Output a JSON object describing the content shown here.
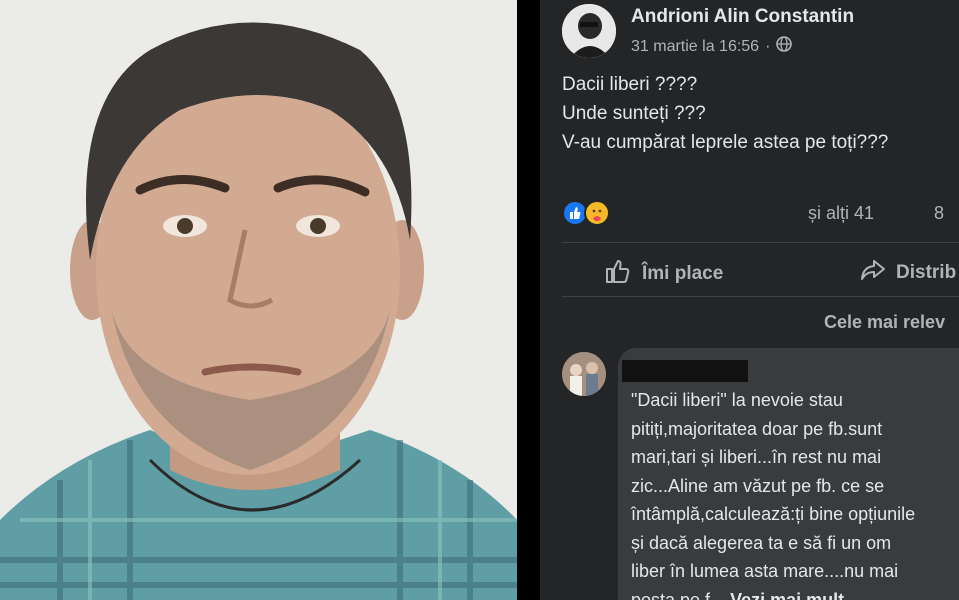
{
  "post": {
    "author": "Andrioni Alin Constantin",
    "timestamp": "31 martie la 16:56",
    "separator": "·",
    "privacy_icon": "globe-icon",
    "lines": [
      "Dacii liberi ????",
      "Unde sunteți ???",
      "V-au cumpărat leprele astea pe toți???"
    ],
    "reactions": [
      "like",
      "care"
    ],
    "others": "și alți 41",
    "comments_count": "8"
  },
  "actions": {
    "like": "Îmi place",
    "share": "Distrib"
  },
  "sort_label": "Cele mai relev",
  "comment": {
    "lines": [
      "\"Dacii liberi\" la nevoie stau",
      "pitiți,majoritatea doar pe fb.sunt",
      "mari,tari și liberi...în rest nu mai",
      "zic...Aline am văzut pe fb. ce se",
      "întâmplă,calculează:ți bine opțiunile",
      "și dacă alegerea ta e să fi un om",
      "liber în lumea asta mare....nu mai"
    ],
    "last_line": "posta pe f...",
    "see_more": "Vezi mai mult"
  },
  "colors": {
    "panel": "#242526",
    "text": "#e4e6eb",
    "muted": "#b0b3b8",
    "bubble": "#3a3b3c",
    "like": "#1877f2",
    "care": "#f7b928"
  }
}
